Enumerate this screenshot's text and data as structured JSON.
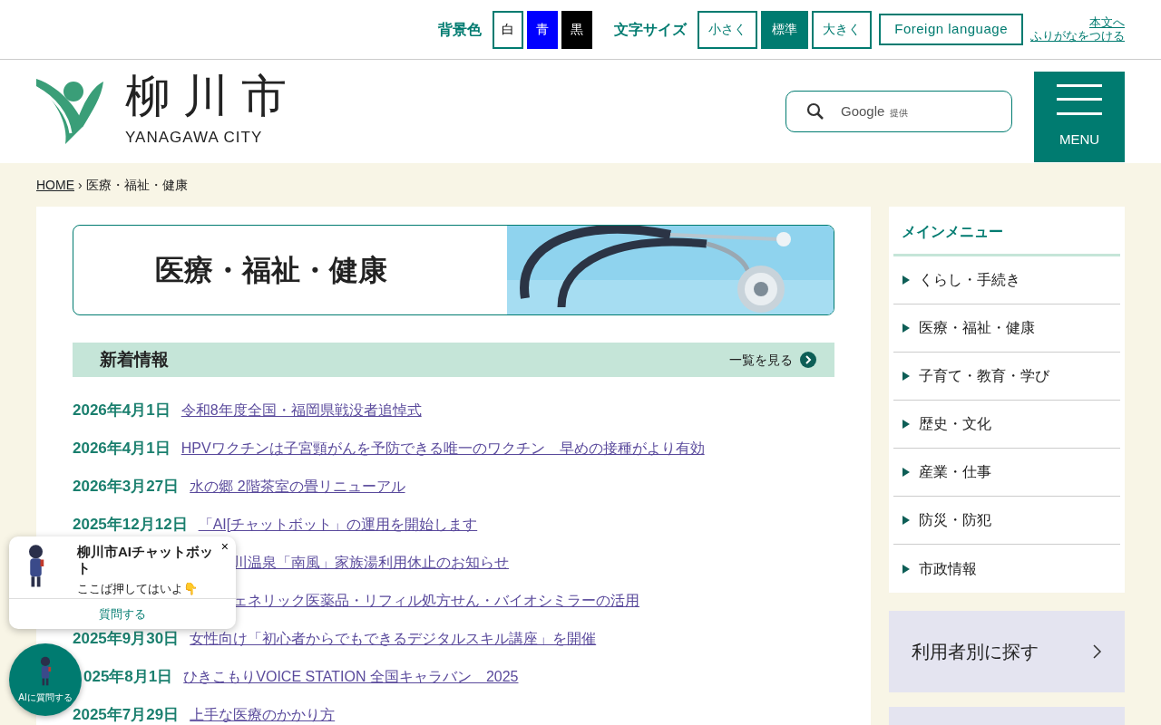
{
  "topbar": {
    "bg_label": "背景色",
    "bg_options": [
      {
        "label": "白",
        "color": "#ffffff"
      },
      {
        "label": "青",
        "color": "#0000ff"
      },
      {
        "label": "黒",
        "color": "#000000"
      }
    ],
    "size_label": "文字サイズ",
    "size_options": [
      {
        "label": "小さく",
        "selected": false
      },
      {
        "label": "標準",
        "selected": true
      },
      {
        "label": "大きく",
        "selected": false
      }
    ],
    "foreign": "Foreign language",
    "skip_link": "本文へ",
    "furigana": "ふりがなをつける"
  },
  "logo": {
    "name": "柳川市",
    "sub": "YANAGAWA CITY"
  },
  "search": {
    "placeholder": "Google",
    "provider": "提供"
  },
  "menu_button": "MENU",
  "breadcrumb": {
    "home": "HOME",
    "separator": "›",
    "current": "医療・福祉・健康"
  },
  "banner": {
    "title": "医療・福祉・健康"
  },
  "news": {
    "title": "新着情報",
    "more": "一覧を見る",
    "items": [
      {
        "date": "2026年4月1日",
        "title": "令和8年度全国・福岡県戦没者追悼式"
      },
      {
        "date": "2026年4月1日",
        "title": "HPVワクチンは子宮頸がんを予防できる唯一のワクチン　早めの接種がより有効"
      },
      {
        "date": "2026年3月27日",
        "title": "水の郷 2階茶室の畳リニューアル"
      },
      {
        "date": "2025年12月12日",
        "title": "「AI[チャットボット」の運用を開始します"
      },
      {
        "title": "川温泉「南風」家族湯利用休止のお知らせ"
      },
      {
        "title": "ェネリック医薬品・リフィル処方せん・バイオシミラーの活用"
      },
      {
        "date": "2025年9月30日",
        "title": "女性向け「初心者からでもできるデジタルスキル講座」を開催"
      },
      {
        "date": "025年8月1日",
        "title": "ひきこもりVOICE STATION 全国キャラバン　2025"
      },
      {
        "date": "2025年7月29日",
        "title": "上手な医療のかかり方"
      }
    ]
  },
  "sidebar": {
    "title": "メインメニュー",
    "items": [
      "くらし・手続き",
      "医療・福祉・健康",
      "子育て・教育・学び",
      "歴史・文化",
      "産業・仕事",
      "防災・防犯",
      "市政情報"
    ],
    "user_search": "利用者別に探す"
  },
  "chat": {
    "title": "柳川市AIチャットボット",
    "message": "ここば押してはいよ👇",
    "ask": "質問する",
    "close": "×",
    "launcher": "AIに質問する"
  }
}
